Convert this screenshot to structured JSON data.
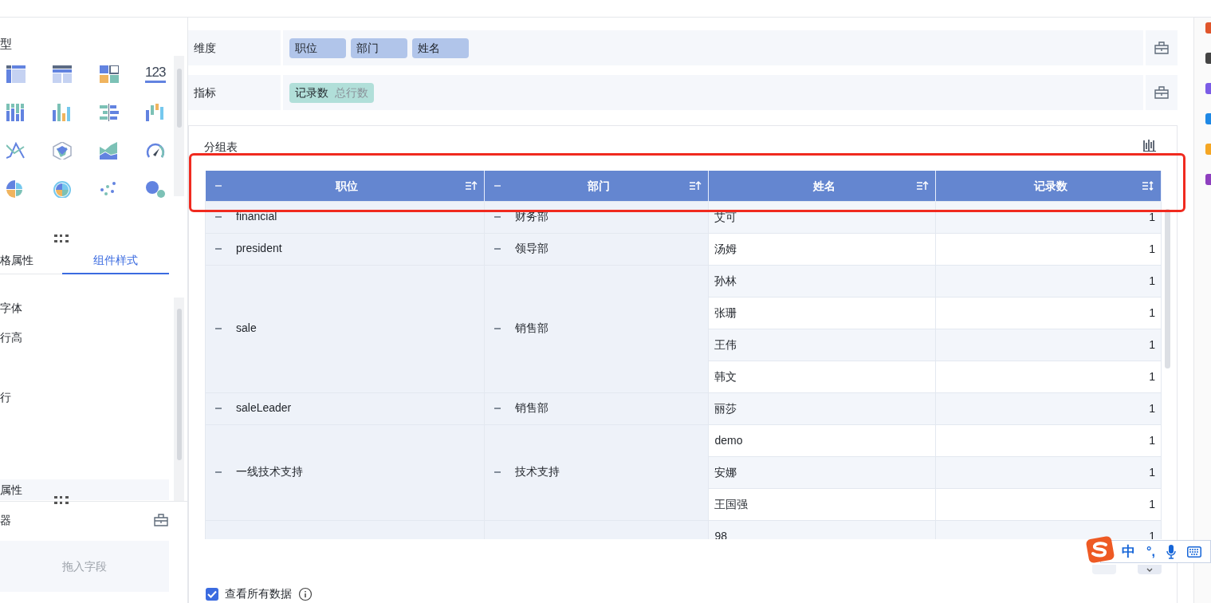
{
  "left_panel": {
    "heading_fragment": "型",
    "chart_types": [
      {
        "kind": "cross-table"
      },
      {
        "kind": "table"
      },
      {
        "kind": "tiles"
      },
      {
        "kind": "number",
        "text": "123"
      },
      {
        "kind": "stacked-bar"
      },
      {
        "kind": "bar"
      },
      {
        "kind": "split-bar"
      },
      {
        "kind": "waterfall"
      },
      {
        "kind": "line"
      },
      {
        "kind": "radar"
      },
      {
        "kind": "area"
      },
      {
        "kind": "gauge"
      },
      {
        "kind": "pie"
      },
      {
        "kind": "rose"
      },
      {
        "kind": "scatter"
      },
      {
        "kind": "bubble"
      }
    ],
    "tabs": [
      {
        "label": "格属性",
        "selected": false
      },
      {
        "label": "组件样式",
        "selected": true
      }
    ],
    "settings": [
      "字体",
      "行高",
      "行",
      "属性"
    ],
    "filter": {
      "title": "器",
      "placeholder": "拖入字段"
    }
  },
  "fields": [
    {
      "label": "维度",
      "chips": [
        {
          "kind": "dimension",
          "text": "职位"
        },
        {
          "kind": "dimension",
          "text": "部门"
        },
        {
          "kind": "dimension",
          "text": "姓名"
        }
      ]
    },
    {
      "label": "指标",
      "chips": [
        {
          "kind": "measure",
          "text": "记录数",
          "hint": "总行数"
        }
      ]
    }
  ],
  "table": {
    "title": "分组表",
    "columns": [
      {
        "label": "职位",
        "collapsible": true,
        "sorted_ascending": true
      },
      {
        "label": "部门",
        "collapsible": true,
        "sorted_ascending": true
      },
      {
        "label": "姓名",
        "collapsible": false,
        "sorted_ascending": true
      },
      {
        "label": "记录数",
        "collapsible": false,
        "sorted_ascending": false
      }
    ],
    "groups": [
      {
        "text": "financial",
        "expanded": true,
        "children": [
          {
            "text": "财务部",
            "expanded": true,
            "rows": [
              {
                "name": "艾可",
                "count": "1"
              }
            ]
          }
        ]
      },
      {
        "text": "president",
        "expanded": true,
        "children": [
          {
            "text": "领导部",
            "expanded": true,
            "rows": [
              {
                "name": "汤姆",
                "count": "1"
              }
            ]
          }
        ]
      },
      {
        "text": "sale",
        "expanded": true,
        "children": [
          {
            "text": "销售部",
            "expanded": true,
            "rows": [
              {
                "name": "孙林",
                "count": "1"
              },
              {
                "name": "张珊",
                "count": "1"
              },
              {
                "name": "王伟",
                "count": "1"
              },
              {
                "name": "韩文",
                "count": "1"
              }
            ]
          }
        ]
      },
      {
        "text": "saleLeader",
        "expanded": true,
        "children": [
          {
            "text": "销售部",
            "expanded": true,
            "rows": [
              {
                "name": "丽莎",
                "count": "1"
              }
            ]
          }
        ]
      },
      {
        "text": "一线技术支持",
        "expanded": true,
        "children": [
          {
            "text": "技术支持",
            "expanded": true,
            "rows": [
              {
                "name": "demo",
                "count": "1"
              },
              {
                "name": "安娜",
                "count": "1"
              },
              {
                "name": "王国强",
                "count": "1"
              }
            ]
          }
        ]
      },
      {
        "children": [
          {
            "rows": [
              {
                "name": "98",
                "count": "1"
              }
            ]
          }
        ]
      }
    ],
    "show_all": {
      "label": "查看所有数据",
      "checked": true
    }
  },
  "ime_bar": {
    "mode": "中",
    "punctuation": "°,"
  }
}
